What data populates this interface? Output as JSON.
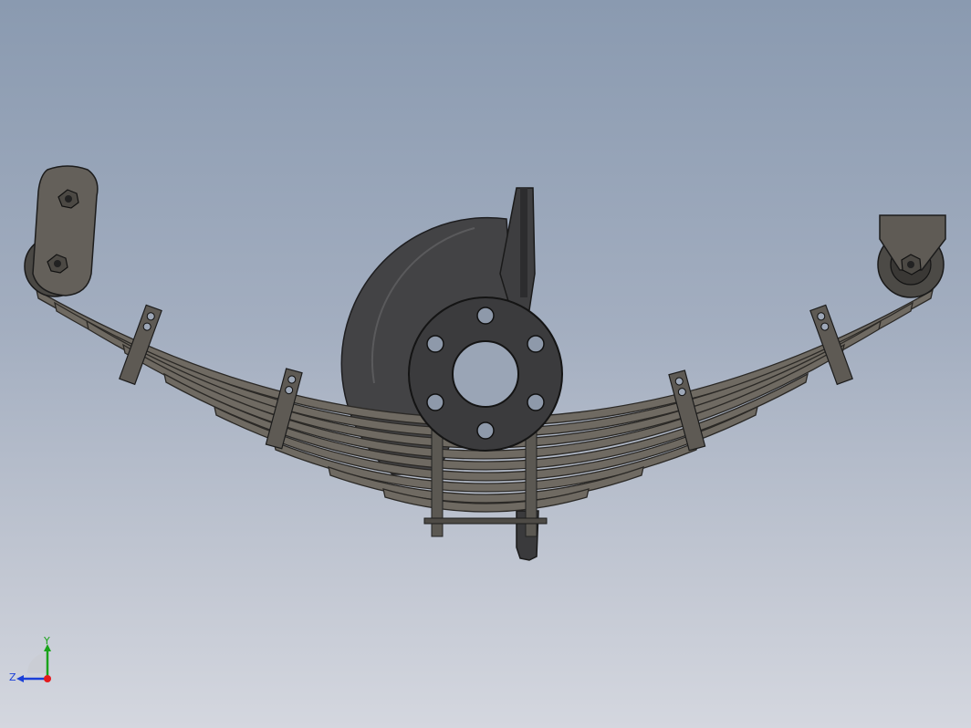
{
  "triad": {
    "x_axis_color": "#e41a1c",
    "y_axis_color": "#1aa31a",
    "z_axis_color": "#1a3fd8",
    "y_label": "Y",
    "z_label": "Z"
  },
  "colors": {
    "leaf": "#6f6a62",
    "leaf_edge": "#2b2926",
    "hub": "#3c3c3e",
    "drum": "#4a4a4c",
    "bracket": "#5e5a54"
  }
}
